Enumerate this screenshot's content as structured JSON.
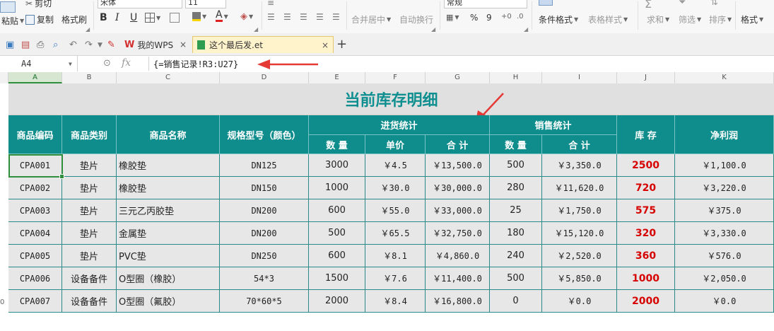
{
  "ribbon": {
    "paste_label": "粘贴",
    "cut_label": "剪切",
    "copy_label": "复制",
    "format_painter_label": "格式刷",
    "font_name": "宋体",
    "font_size": "11",
    "bold": "B",
    "italic": "I",
    "underline": "U",
    "merge_center_label": "合并居中",
    "wrap_text_label": "自动换行",
    "number_format": "常规",
    "percent_symbol": "%",
    "thousands_symbol": "9",
    "conditional_format_label": "条件格式",
    "table_style_label": "表格样式",
    "sum_label": "求和",
    "filter_label": "筛选",
    "sort_label": "排序",
    "format_label": "格式",
    "sum_symbol": "Σ"
  },
  "tabs": [
    {
      "label": "我的WPS",
      "close": "×"
    },
    {
      "label": "这个最后发.et",
      "close": "×"
    }
  ],
  "new_tab_symbol": "+",
  "name_box": "A4",
  "fx_label": "fx",
  "formula": "{=销售记录!R3:U27}",
  "columns": [
    "A",
    "B",
    "C",
    "D",
    "E",
    "F",
    "G",
    "H",
    "I",
    "J",
    "K"
  ],
  "sheet": {
    "title": "当前库存明细",
    "headers": {
      "code": "商品编码",
      "category": "商品类别",
      "name": "商品名称",
      "spec": "规格型号（颜色）",
      "purchase": "进货统计",
      "sales": "销售统计",
      "stock": "库 存",
      "profit": "净利润",
      "p_qty": "数 量",
      "p_price": "单价",
      "p_total": "合 计",
      "s_qty": "数 量",
      "s_total": "合 计"
    },
    "rows": [
      [
        "CPA001",
        "垫片",
        "橡胶垫",
        "DN125",
        "3000",
        "￥4.5",
        "￥13,500.0",
        "500",
        "￥3,350.0",
        "2500",
        "￥1,100.0"
      ],
      [
        "CPA002",
        "垫片",
        "橡胶垫",
        "DN150",
        "1000",
        "￥30.0",
        "￥30,000.0",
        "280",
        "￥11,620.0",
        "720",
        "￥3,220.0"
      ],
      [
        "CPA003",
        "垫片",
        "三元乙丙胶垫",
        "DN200",
        "600",
        "￥55.0",
        "￥33,000.0",
        "25",
        "￥1,750.0",
        "575",
        "￥375.0"
      ],
      [
        "CPA004",
        "垫片",
        "金属垫",
        "DN200",
        "500",
        "￥65.5",
        "￥32,750.0",
        "180",
        "￥15,120.0",
        "320",
        "￥3,330.0"
      ],
      [
        "CPA005",
        "垫片",
        "PVC垫",
        "DN250",
        "600",
        "￥8.1",
        "￥4,860.0",
        "240",
        "￥2,520.0",
        "360",
        "￥576.0"
      ],
      [
        "CPA006",
        "设备备件",
        "O型圈（橡胶）",
        "54*3",
        "1500",
        "￥7.6",
        "￥11,400.0",
        "500",
        "￥5,850.0",
        "1000",
        "￥2,050.0"
      ],
      [
        "CPA007",
        "设备备件",
        "O型圈（氟胶）",
        "70*60*5",
        "2000",
        "￥8.4",
        "￥16,800.0",
        "0",
        "￥0.0",
        "2000",
        "￥0.0"
      ]
    ]
  },
  "row_number_partial": "0",
  "colors": {
    "header_teal": "#0f8c8c",
    "title_teal": "#0f8f8f",
    "stock_red": "#d60000",
    "annotation_red": "#e53935"
  }
}
